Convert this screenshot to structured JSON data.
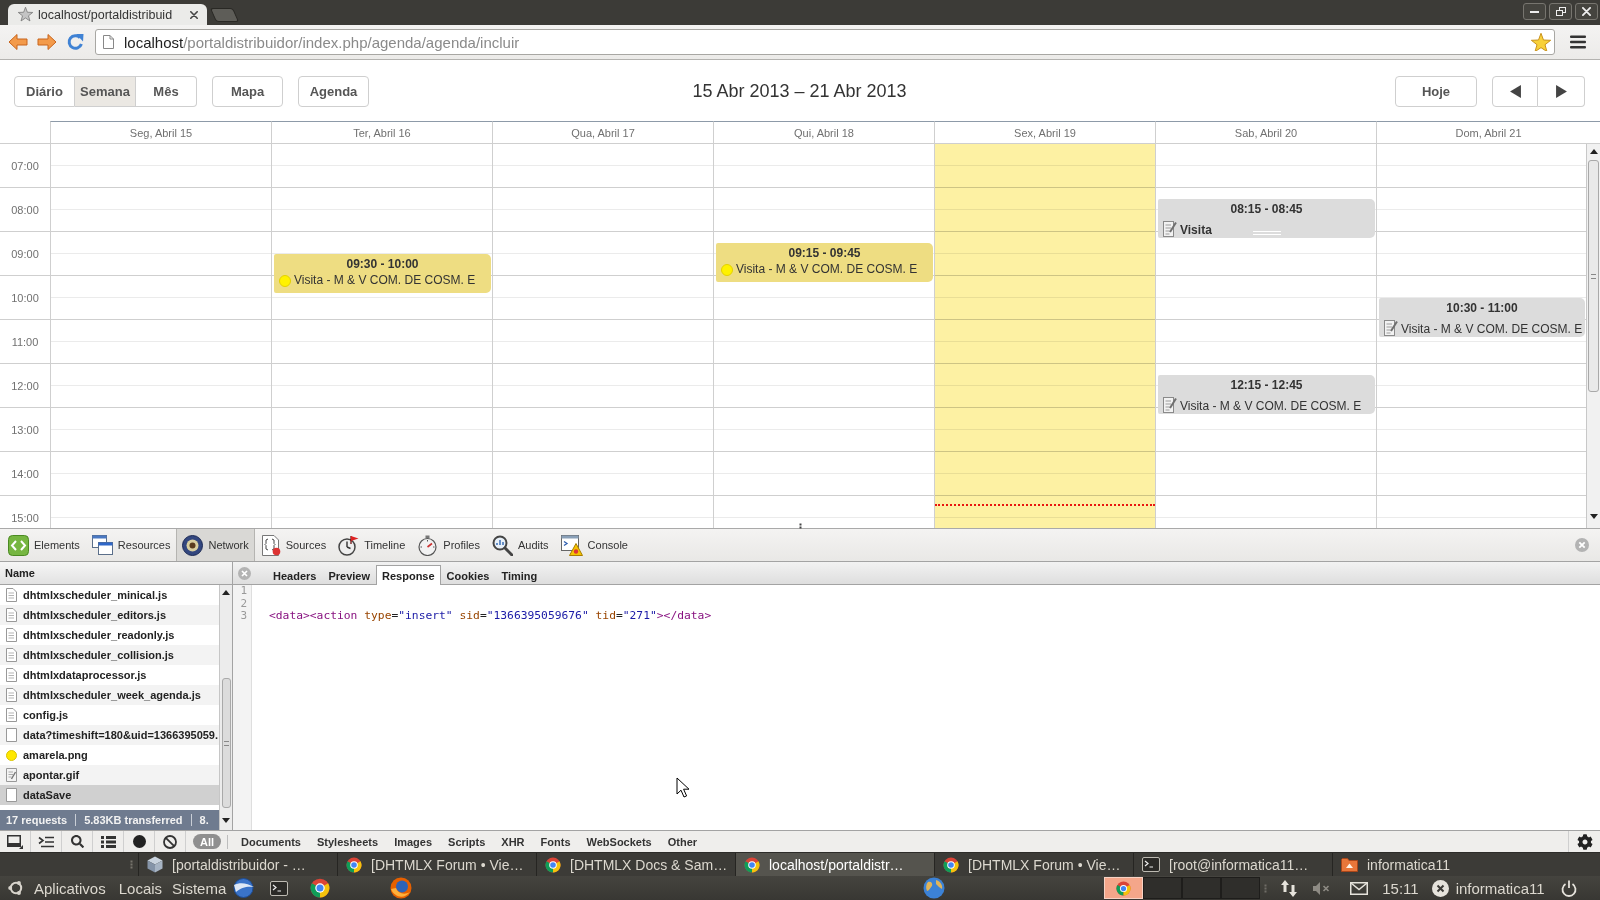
{
  "browser": {
    "tabs": [
      {
        "title": "localhost/portaldistribuid",
        "selected": true
      }
    ],
    "address": {
      "host": "localhost",
      "path": "/portaldistribuidor/index.php/agenda/agenda/incluir"
    }
  },
  "scheduler": {
    "views": [
      {
        "label": "Diário",
        "selected": false
      },
      {
        "label": "Semana",
        "selected": true
      },
      {
        "label": "Mês",
        "selected": false
      }
    ],
    "buttons": [
      "Mapa",
      "Agenda"
    ],
    "title": "15 Abr 2013 – 21 Abr 2013",
    "today_button": "Hoje",
    "days": [
      {
        "label": "Seg, Abril 15",
        "today": false
      },
      {
        "label": "Ter, Abril 16",
        "today": false,
        "events": [
          {
            "time": "09:30 - 10:00",
            "text": "Visita - M & V COM. DE COSM. E",
            "kind": "dot",
            "color": "#eedd82",
            "selected": false
          }
        ]
      },
      {
        "label": "Qua, Abril 17",
        "today": false
      },
      {
        "label": "Qui, Abril 18",
        "today": false,
        "events": [
          {
            "time": "09:15 - 09:45",
            "text": "Visita - M & V COM. DE COSM. E",
            "kind": "dot",
            "color": "#eedd82",
            "selected": false
          }
        ]
      },
      {
        "label": "Sex, Abril 19",
        "today": true
      },
      {
        "label": "Sab, Abril 20",
        "today": false,
        "events": [
          {
            "time": "08:15 - 08:45",
            "text": "Visita",
            "kind": "note",
            "color": "#dcdcdc",
            "selected": true
          },
          {
            "time": "12:15 - 12:45",
            "text": "Visita - M & V COM. DE COSM. E",
            "kind": "note",
            "color": "#dcdcdc",
            "selected": false
          }
        ]
      },
      {
        "label": "Dom, Abril 21",
        "today": false,
        "events": [
          {
            "time": "10:30 - 11:00",
            "text": "Visita - M & V COM. DE COSM. E",
            "kind": "note",
            "color": "#dcdcdc",
            "selected": false
          }
        ]
      }
    ],
    "hours": [
      "07:00",
      "08:00",
      "09:00",
      "10:00",
      "11:00",
      "12:00",
      "13:00",
      "14:00",
      "15:00"
    ]
  },
  "devtools": {
    "panels": [
      {
        "label": "Elements",
        "selected": false
      },
      {
        "label": "Resources",
        "selected": false
      },
      {
        "label": "Network",
        "selected": true
      },
      {
        "label": "Sources",
        "selected": false
      },
      {
        "label": "Timeline",
        "selected": false
      },
      {
        "label": "Profiles",
        "selected": false
      },
      {
        "label": "Audits",
        "selected": false
      },
      {
        "label": "Console",
        "selected": false
      }
    ],
    "requests": {
      "header": "Name",
      "items": [
        {
          "name": "dhtmlxscheduler_minical.js",
          "kind": "script",
          "selected": false
        },
        {
          "name": "dhtmlxscheduler_editors.js",
          "kind": "script",
          "selected": false
        },
        {
          "name": "dhtmlxscheduler_readonly.js",
          "kind": "script",
          "selected": false
        },
        {
          "name": "dhtmlxscheduler_collision.js",
          "kind": "script",
          "selected": false
        },
        {
          "name": "dhtmlxdataprocessor.js",
          "kind": "script",
          "selected": false
        },
        {
          "name": "dhtmlxscheduler_week_agenda.js",
          "kind": "script",
          "selected": false
        },
        {
          "name": "config.js",
          "kind": "script",
          "selected": false
        },
        {
          "name": "data?timeshift=180&uid=1366395059.",
          "kind": "document",
          "selected": false
        },
        {
          "name": "amarela.png",
          "kind": "dot",
          "selected": false
        },
        {
          "name": "apontar.gif",
          "kind": "note",
          "selected": false
        },
        {
          "name": "dataSave",
          "kind": "document",
          "selected": true
        }
      ],
      "summary": [
        "17 requests",
        "5.83KB transferred",
        "8."
      ]
    },
    "detail_tabs": [
      {
        "label": "Headers",
        "selected": false
      },
      {
        "label": "Preview",
        "selected": false
      },
      {
        "label": "Response",
        "selected": true
      },
      {
        "label": "Cookies",
        "selected": false
      },
      {
        "label": "Timing",
        "selected": false
      }
    ],
    "response_lines": [
      {
        "number": "1"
      },
      {
        "number": "2"
      },
      {
        "number": "3",
        "tokens": [
          {
            "kind": "tag",
            "text": "<data><action"
          },
          {
            "kind": "attr",
            "text": " type"
          },
          {
            "kind": "plain",
            "text": "="
          },
          {
            "kind": "value",
            "text": "\"insert\""
          },
          {
            "kind": "attr",
            "text": " sid"
          },
          {
            "kind": "plain",
            "text": "="
          },
          {
            "kind": "value",
            "text": "\"1366395059676\""
          },
          {
            "kind": "attr",
            "text": " tid"
          },
          {
            "kind": "plain",
            "text": "="
          },
          {
            "kind": "value",
            "text": "\"271\""
          },
          {
            "kind": "tag",
            "text": "></data>"
          }
        ]
      }
    ],
    "filters": [
      {
        "label": "All",
        "selected": true
      },
      {
        "label": "Documents",
        "selected": false
      },
      {
        "label": "Stylesheets",
        "selected": false
      },
      {
        "label": "Images",
        "selected": false
      },
      {
        "label": "Scripts",
        "selected": false
      },
      {
        "label": "XHR",
        "selected": false
      },
      {
        "label": "Fonts",
        "selected": false
      },
      {
        "label": "WebSockets",
        "selected": false
      },
      {
        "label": "Other",
        "selected": false
      }
    ]
  },
  "window_list": [
    {
      "title": "[portaldistribuidor - …",
      "kind": "app",
      "selected": false
    },
    {
      "title": "[DHTMLX Forum • Vie…",
      "kind": "browser",
      "selected": false
    },
    {
      "title": "[DHTMLX Docs & Sam…",
      "kind": "browser",
      "selected": false
    },
    {
      "title": "localhost/portaldistr…",
      "kind": "browser",
      "selected": true
    },
    {
      "title": "[DHTMLX Forum • Vie…",
      "kind": "browser",
      "selected": false
    },
    {
      "title": "[root@informatica11…",
      "kind": "terminal",
      "selected": false
    },
    {
      "title": "informatica11",
      "kind": "folder",
      "selected": false
    }
  ],
  "panel": {
    "menus": [
      "Aplicativos",
      "Locais",
      "Sistema"
    ],
    "workspaces": [
      {
        "selected": true
      },
      {
        "selected": false
      },
      {
        "selected": false
      },
      {
        "selected": false
      }
    ],
    "clock": "15:11",
    "user": "informatica11"
  }
}
